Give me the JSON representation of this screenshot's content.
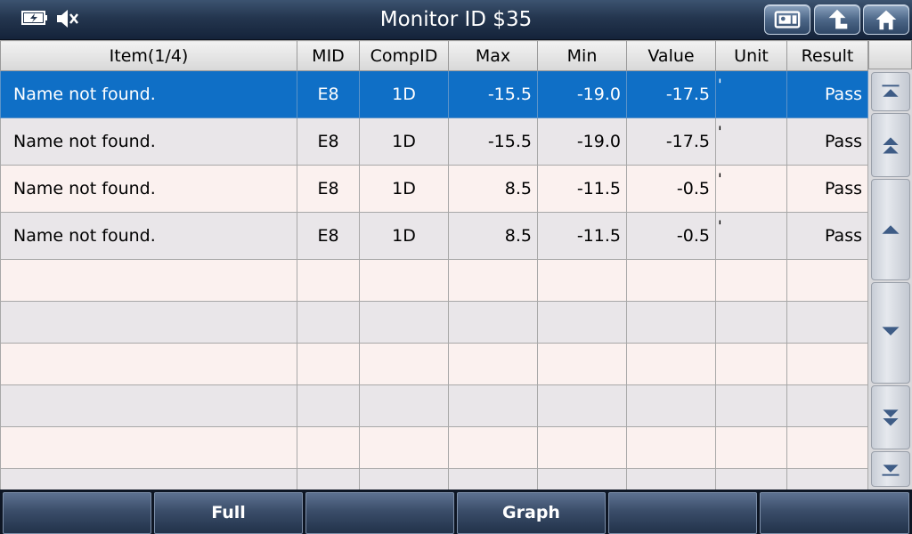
{
  "header": {
    "title": "Monitor ID $35",
    "icons": [
      "battery-icon",
      "mute-icon",
      "report-icon",
      "back-icon",
      "home-icon"
    ]
  },
  "table": {
    "columns": [
      "Item(1/4)",
      "MID",
      "CompID",
      "Max",
      "Min",
      "Value",
      "Unit",
      "Result"
    ],
    "rows": [
      {
        "item": "Name not found.",
        "mid": "E8",
        "compid": "1D",
        "max": "-15.5",
        "min": "-19.0",
        "value": "-17.5",
        "unit": "'",
        "result": "Pass"
      },
      {
        "item": "Name not found.",
        "mid": "E8",
        "compid": "1D",
        "max": "-15.5",
        "min": "-19.0",
        "value": "-17.5",
        "unit": "'",
        "result": "Pass"
      },
      {
        "item": "Name not found.",
        "mid": "E8",
        "compid": "1D",
        "max": "8.5",
        "min": "-11.5",
        "value": "-0.5",
        "unit": "'",
        "result": "Pass"
      },
      {
        "item": "Name not found.",
        "mid": "E8",
        "compid": "1D",
        "max": "8.5",
        "min": "-11.5",
        "value": "-0.5",
        "unit": "'",
        "result": "Pass"
      }
    ],
    "selected_row": 1
  },
  "scroll": {
    "icons": [
      "scroll-top-icon",
      "page-up-icon",
      "line-up-icon",
      "line-down-icon",
      "page-down-icon",
      "scroll-bottom-icon"
    ]
  },
  "footer": {
    "buttons": [
      "",
      "Full",
      "",
      "Graph",
      "",
      ""
    ]
  },
  "colors": {
    "selected_row": "#0f6fc6",
    "header_bar": "#24364f"
  }
}
